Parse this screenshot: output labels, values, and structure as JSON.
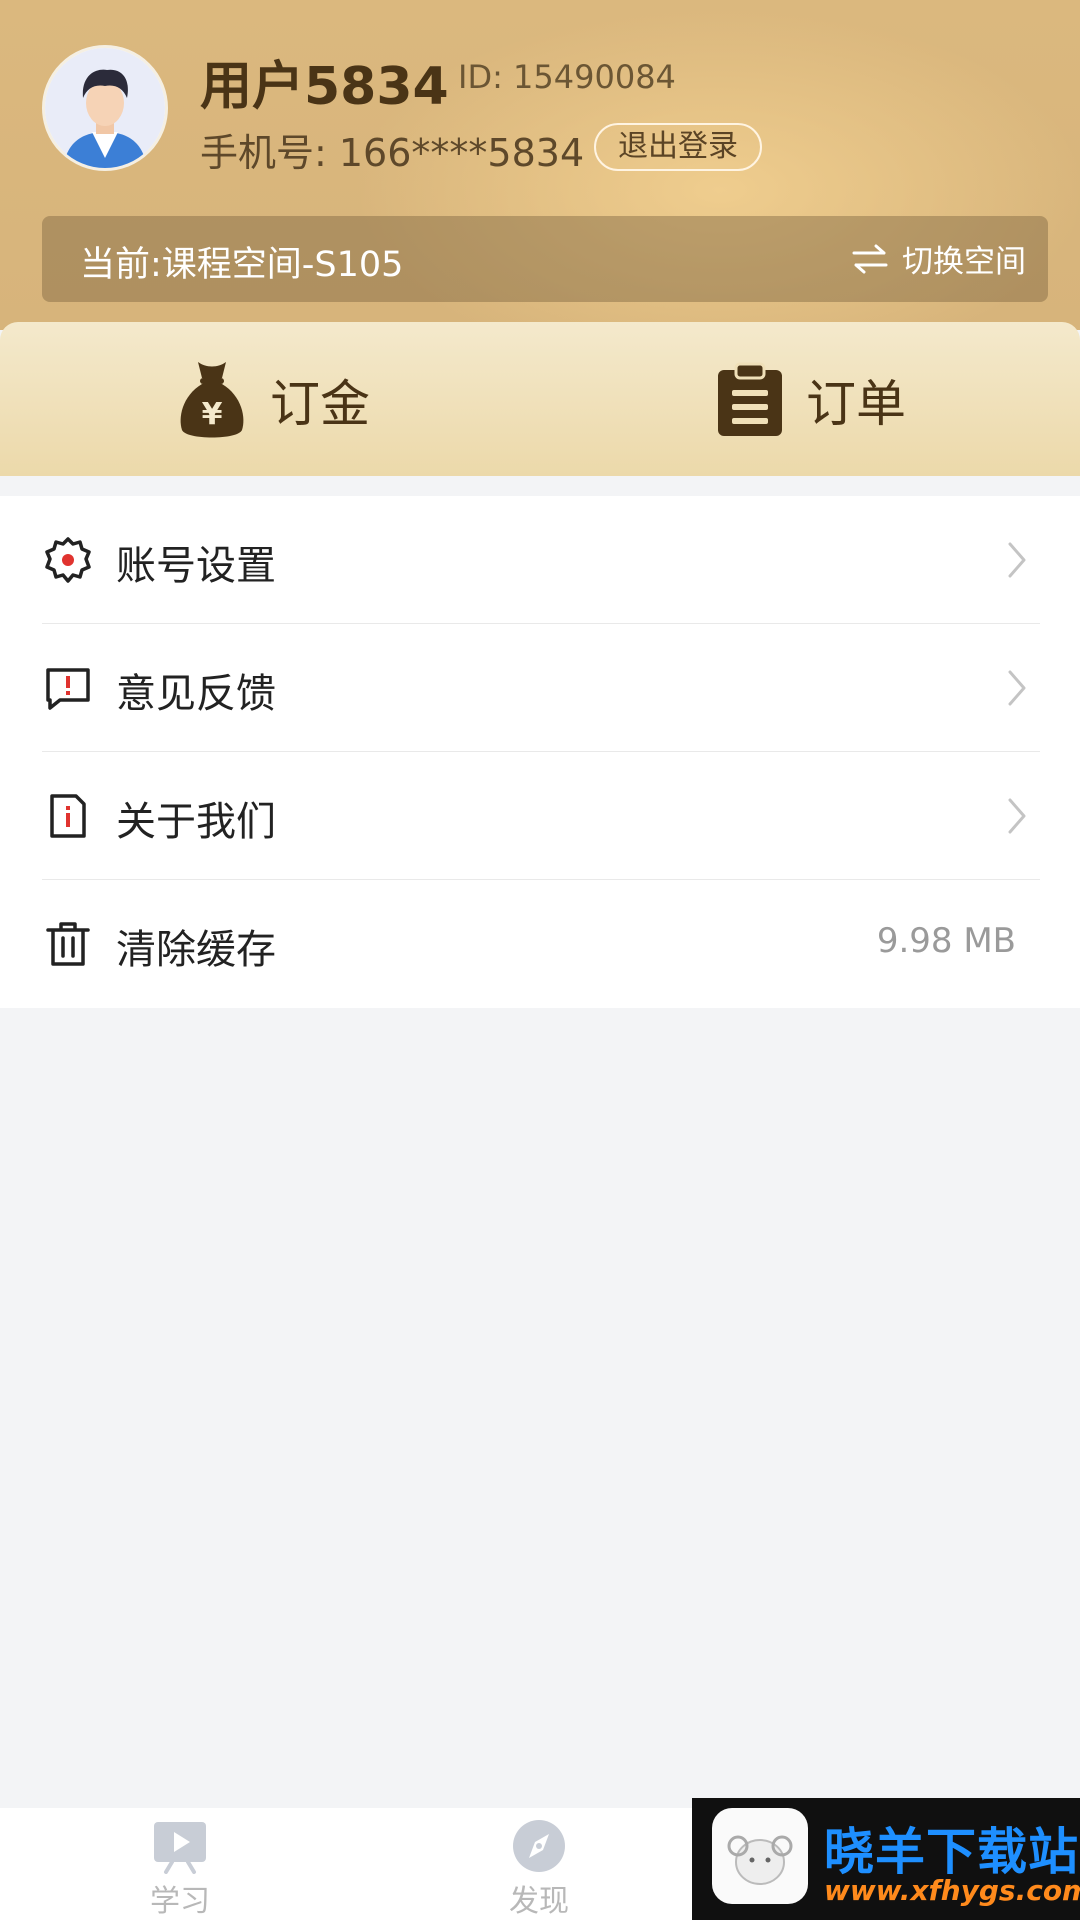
{
  "profile": {
    "username": "用户5834",
    "id_text": "ID: 15490084",
    "phone_text": "手机号: 166****5834",
    "logout_label": "退出登录"
  },
  "space": {
    "current": "当前:课程空间-S105",
    "switch_label": "切换空间"
  },
  "quick_actions": [
    {
      "label": "订金",
      "icon": "money-bag-icon"
    },
    {
      "label": "订单",
      "icon": "clipboard-icon"
    }
  ],
  "menu": [
    {
      "label": "账号设置",
      "icon": "gear-icon",
      "trailing": "chevron"
    },
    {
      "label": "意见反馈",
      "icon": "feedback-icon",
      "trailing": "chevron"
    },
    {
      "label": "关于我们",
      "icon": "info-icon",
      "trailing": "chevron"
    },
    {
      "label": "清除缓存",
      "icon": "trash-icon",
      "trailing": "value",
      "value": "9.98 MB"
    }
  ],
  "tabbar": [
    {
      "label": "学习",
      "icon": "play-icon"
    },
    {
      "label": "发现",
      "icon": "compass-icon"
    }
  ],
  "watermark": {
    "title": "晓羊下载站",
    "url": "www.xfhygs.com"
  },
  "colors": {
    "header_gold": "#d7b47b",
    "accent_brown": "#4a3416",
    "icon_red": "#e0332f"
  }
}
